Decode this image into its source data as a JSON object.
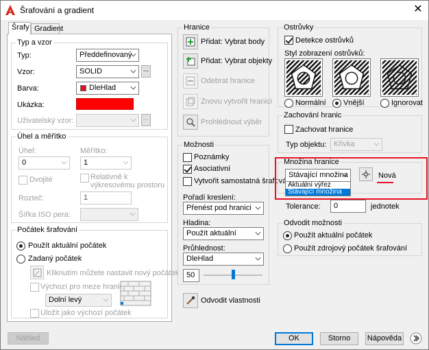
{
  "window": {
    "title": "Šrafování a gradient",
    "tabs": [
      "Šrafy",
      "Gradient"
    ]
  },
  "colors": {
    "swatch": "#ff0000",
    "highlight_border": "#e81123",
    "selection": "#0078d7"
  },
  "typ_a_vzor": {
    "title": "Typ a vzor",
    "typ_label": "Typ:",
    "typ_value": "Předdefinovaný",
    "vzor_label": "Vzor:",
    "vzor_value": "SOLID",
    "barva_label": "Barva:",
    "barva_value": "DleHlad",
    "ukazka_label": "Ukázka:",
    "uziv_vzor_label": "Uživatelský vzor:",
    "dots": "..."
  },
  "uhel": {
    "title": "Úhel a měřítko",
    "uhel_label": "Úhel:",
    "uhel_value": "0",
    "meritko_label": "Měřítko:",
    "meritko_value": "1",
    "dvojite_label": "Dvojité",
    "relativne_label": "Relativně k výkresovému prostoru",
    "roztec_label": "Rozteč:",
    "roztec_value": "1",
    "sirka_label": "Šířka ISO pera:"
  },
  "pocatek": {
    "title": "Počátek šrafování",
    "pouzit_label": "Použít aktuální počátek",
    "zadany_label": "Zadaný počátek",
    "kliknutim_label": "Kliknutím můžete nastavit nový počátek",
    "vychozi_label": "Výchozí pro meze hranice",
    "dolni_value": "Dolní levý",
    "ulozit_label": "Uložit jako výchozí počátek"
  },
  "hranice": {
    "title": "Hranice",
    "pridat_body": "Přidat: Vybrat body",
    "pridat_objekty": "Přidat: Vybrat objekty",
    "odebrat": "Odebrat hranice",
    "znovu": "Znovu vytvořit hranici",
    "prohlednout": "Prohlédnout výběr"
  },
  "moznosti": {
    "title": "Možnosti",
    "poznamky": "Poznámky",
    "asociativni": "Asociativní",
    "vytvorit": "Vytvořit samostatná šrafování",
    "poradi_label": "Pořadí kreslení:",
    "poradi_value": "Přenést pod hranici",
    "hladina_label": "Hladina:",
    "hladina_value": "Použít aktuální",
    "pruhlednost_label": "Průhlednost:",
    "pruhlednost_value": "DleHlad",
    "slider_value": "50",
    "slider_fraction": 0.5,
    "odvodit": "Odvodit vlastnosti"
  },
  "ostrovky": {
    "title": "Ostrůvky",
    "detekce_label": "Detekce ostrůvků",
    "styl_label": "Styl zobrazení ostrůvků:",
    "normalni": "Normální",
    "vnejsi": "Vnější",
    "ignorovat": "Ignorovat"
  },
  "zachovani": {
    "title": "Zachování hranic",
    "zachovat_label": "Zachovat hranice",
    "typ_label": "Typ objektu:",
    "typ_value": "Křivka"
  },
  "mnozina": {
    "title": "Množina hranice",
    "value": "Stávající množina",
    "options": [
      "Aktuální výřez",
      "Stávající množina"
    ],
    "nova_label": "Nová"
  },
  "tolerance": {
    "label": "Tolerance:",
    "value": "0",
    "unit": "jednotek"
  },
  "odvodit_moznosti": {
    "title": "Odvodit možnosti",
    "aktualni": "Použít aktuální počátek",
    "zdrojovy": "Použít zdrojový počátek šrafování"
  },
  "footer": {
    "nahled": "Náhled",
    "ok": "OK",
    "storno": "Storno",
    "napoveda": "Nápověda"
  }
}
